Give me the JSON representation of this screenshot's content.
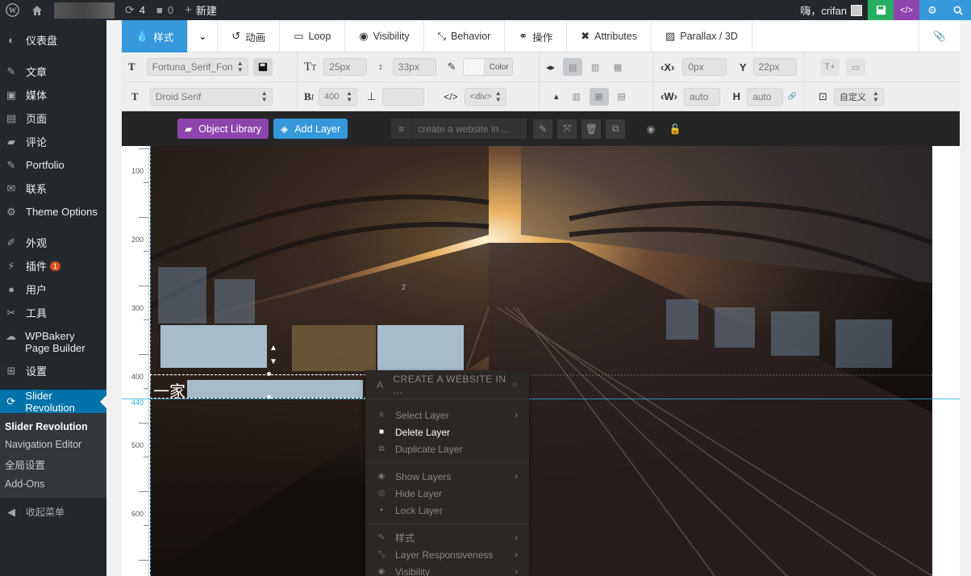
{
  "adminbar": {
    "updates_count": "4",
    "comments_count": "0",
    "new_label": "新建",
    "greeting": "嗨，crifan"
  },
  "sidebar": {
    "items": [
      {
        "label": "仪表盘",
        "icon": "dashboard-icon"
      },
      {
        "label": "文章",
        "icon": "pin-icon"
      },
      {
        "label": "媒体",
        "icon": "media-icon"
      },
      {
        "label": "页面",
        "icon": "page-icon"
      },
      {
        "label": "评论",
        "icon": "comment-icon"
      },
      {
        "label": "Portfolio",
        "icon": "pin-icon"
      },
      {
        "label": "联系",
        "icon": "mail-icon"
      },
      {
        "label": "Theme Options",
        "icon": "gear-icon"
      },
      {
        "label": "外观",
        "icon": "brush-icon"
      },
      {
        "label": "插件",
        "icon": "plugin-icon",
        "badge": "1"
      },
      {
        "label": "用户",
        "icon": "user-icon"
      },
      {
        "label": "工具",
        "icon": "wrench-icon"
      },
      {
        "label": "WPBakery Page Builder",
        "icon": "cloud-icon"
      },
      {
        "label": "设置",
        "icon": "settings-icon"
      },
      {
        "label": "Slider Revolution",
        "icon": "refresh-icon"
      }
    ],
    "submenu": [
      "Slider Revolution",
      "Navigation Editor",
      "全局设置",
      "Add-Ons"
    ],
    "collapse": "收起菜单"
  },
  "tabs": [
    "样式",
    "动画",
    "Loop",
    "Visibility",
    "Behavior",
    "操作",
    "Attributes",
    "Parallax / 3D"
  ],
  "toolbar": {
    "font_family": "Fortuna_Serif_Fon",
    "font_size": "25px",
    "line_height": "33px",
    "color_label": "Color",
    "x_value": "0px",
    "y_value": "22px",
    "font_family2": "Droid Serif",
    "font_weight": "400",
    "tag": "<div>",
    "w_value": "auto",
    "h_value": "auto",
    "custom": "自定义",
    "x_label": "X",
    "y_label": "Y",
    "w_label": "W",
    "h_label": "H"
  },
  "layerbar": {
    "object_library": "Object Library",
    "add_layer": "Add Layer",
    "layer_name": "create a website in ..."
  },
  "ruler": {
    "ticks": [
      "100",
      "200",
      "300",
      "400",
      "440",
      "500",
      "600"
    ]
  },
  "canvas": {
    "marker_number": "2",
    "partial_text": "一家"
  },
  "context_menu": {
    "header": "CREATE A WEBSITE IN ...",
    "items": [
      {
        "label": "Select Layer",
        "arrow": true,
        "bright": false
      },
      {
        "label": "Delete Layer",
        "arrow": false,
        "bright": true
      },
      {
        "label": "Duplicate Layer",
        "arrow": false,
        "bright": false
      },
      {
        "label": "Show Layers",
        "arrow": true,
        "bright": false
      },
      {
        "label": "Hide Layer",
        "arrow": false,
        "bright": false
      },
      {
        "label": "Lock Layer",
        "arrow": false,
        "bright": false
      },
      {
        "label": "样式",
        "arrow": true,
        "bright": false
      },
      {
        "label": "Layer Responsiveness",
        "arrow": true,
        "bright": false
      },
      {
        "label": "Visibility",
        "arrow": true,
        "bright": false
      }
    ]
  },
  "colors": {
    "admin_bar": "#23282d",
    "accent_blue": "#3498db",
    "object_library_purple": "#8e44ad",
    "save_green": "#27ae60",
    "code_purple": "#8e44ad",
    "badge_orange": "#d54e21"
  }
}
